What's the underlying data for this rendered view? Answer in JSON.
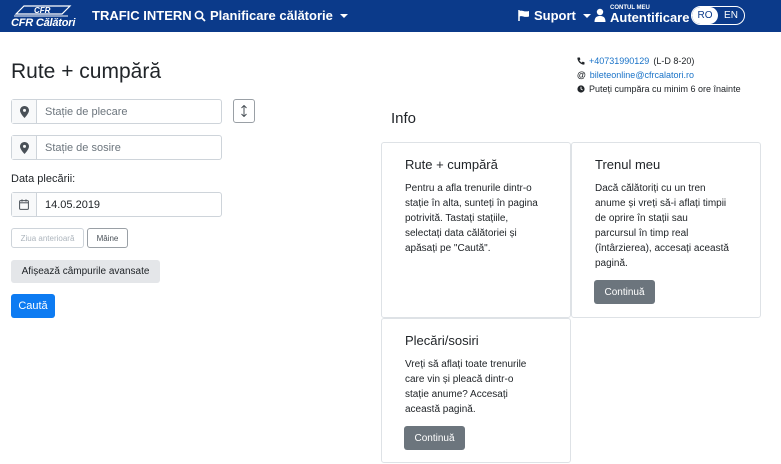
{
  "navbar": {
    "logo_text": "CFR Călători",
    "trafic": "TRAFIC INTERN",
    "planificare": "Planificare călătorie",
    "suport": "Suport",
    "account_small": "CONTUL MEU",
    "account_big": "Autentificare",
    "lang_ro": "RO",
    "lang_en": "EN"
  },
  "contact": {
    "phone": "+40731990129",
    "hours": "(L-D 8-20)",
    "email": "bileteonline@cfrcalatori.ro",
    "notice": "Puteți cumpăra cu minim 6 ore înainte"
  },
  "form": {
    "title": "Rute + cumpără",
    "departure_placeholder": "Stație de plecare",
    "arrival_placeholder": "Stație de sosire",
    "date_label": "Data plecării:",
    "date_value": "14.05.2019",
    "prev_day": "Ziua anterioară",
    "next_day": "Mâine",
    "advanced": "Afișează câmpurile avansate",
    "search": "Caută"
  },
  "info": {
    "title": "Info",
    "cards": [
      {
        "title": "Rute + cumpără",
        "lines": [
          "Pentru a afla trenurile dintr-o",
          "stație în alta, sunteți în pagina",
          "potrivită. Tastați stațiile,",
          "selectați data călătoriei și",
          "apăsați pe \"Caută\"."
        ]
      },
      {
        "title": "Trenul meu",
        "lines": [
          "Dacă călătoriți cu un tren",
          "anume și vreți să-i aflați timpii",
          "de oprire în stații sau",
          "parcursul în timp real",
          "(întârzierea), accesați această",
          "pagină."
        ],
        "button": "Continuă"
      },
      {
        "title": "Plecări/sosiri",
        "lines": [
          "Vreți să aflați toate trenurile",
          "care vin și pleacă dintr-o",
          "stație anume? Accesați",
          "această pagină."
        ],
        "button": "Continuă"
      }
    ]
  },
  "colors": {
    "navbar": "#0b3a8a",
    "primary": "#0d7bf2",
    "secondary": "#6c757d"
  },
  "icons": [
    "logo-train",
    "search-icon",
    "flag-icon",
    "user-icon",
    "phone-icon",
    "at-icon",
    "clock-icon",
    "map-marker-icon",
    "swap-icon",
    "calendar-icon"
  ]
}
